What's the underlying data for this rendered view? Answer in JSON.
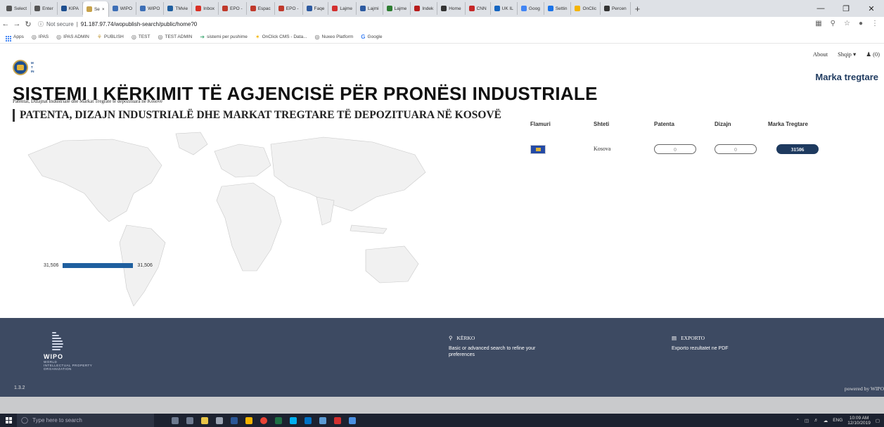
{
  "browser": {
    "tabs": [
      {
        "label": "Select",
        "color": "#555"
      },
      {
        "label": "Enter",
        "color": "#555"
      },
      {
        "label": "KIPA",
        "color": "#1d4e8f"
      },
      {
        "label": "Se",
        "color": "#c7a24a",
        "active": true
      },
      {
        "label": "WIPO",
        "color": "#3d6fb6"
      },
      {
        "label": "WIPO",
        "color": "#3d6fb6"
      },
      {
        "label": "TMvie",
        "color": "#1f5f9f"
      },
      {
        "label": "Inbox",
        "color": "#d93025"
      },
      {
        "label": "EPO -",
        "color": "#c0392b"
      },
      {
        "label": "Espac",
        "color": "#c0392b"
      },
      {
        "label": "EPO -",
        "color": "#c0392b"
      },
      {
        "label": "Faqe",
        "color": "#2d5aa0"
      },
      {
        "label": "Lajme",
        "color": "#d32f2f"
      },
      {
        "label": "Lajmi",
        "color": "#2d5aa0"
      },
      {
        "label": "Lajme",
        "color": "#2e7d32"
      },
      {
        "label": "Indek",
        "color": "#b71c1c"
      },
      {
        "label": "Home",
        "color": "#333"
      },
      {
        "label": "CNN",
        "color": "#c62828"
      },
      {
        "label": "UK IL",
        "color": "#1565c0"
      },
      {
        "label": "Goog",
        "color": "#4285f4"
      },
      {
        "label": "Settin",
        "color": "#1a73e8"
      },
      {
        "label": "OnClic",
        "color": "#f4b400"
      },
      {
        "label": "Percen",
        "color": "#333"
      }
    ],
    "url_prefix": "Not secure",
    "url": "91.187.97.74/wopublish-search/public/home?0",
    "bookmarks": [
      {
        "label": "Apps",
        "icon": "apps-grid-icon"
      },
      {
        "label": "IPAS",
        "icon": "globe-icon"
      },
      {
        "label": "IPAS ADMIN",
        "icon": "globe-icon"
      },
      {
        "label": "PUBLISH",
        "icon": "kipa-logo-icon"
      },
      {
        "label": "TEST",
        "icon": "globe-icon"
      },
      {
        "label": "TEST ADMIN",
        "icon": "globe-icon"
      },
      {
        "label": "sistemi per pushime",
        "icon": "arrow-icon"
      },
      {
        "label": "OnClick CMS - Data...",
        "icon": "onclick-icon"
      },
      {
        "label": "Nuxeo Platform",
        "icon": "globe-icon"
      },
      {
        "label": "Google",
        "icon": "google-icon"
      }
    ]
  },
  "header": {
    "about": "About",
    "language": "Shqip",
    "cart": "(0)",
    "logo_letters": [
      "M",
      "T",
      "IN"
    ],
    "marka": "Marka tregtare"
  },
  "main": {
    "title": "SISTEMI I KËRKIMIT TË AGJENCISË PËR PRONËSI INDUSTRIALE",
    "subtitle": "Patentat, Dizajnat Industriale dhe Markat Tregrate të depozituara në Kosovë",
    "section_title": "PATENTA, DIZAJN INDUSTRIALË DHE MARKAT TREGTARE TË DEPOZITUARA NË KOSOVË",
    "bar_min": "31,506",
    "bar_max": "31,506"
  },
  "table": {
    "headers": {
      "flag": "Flamuri",
      "country": "Shteti",
      "patent": "Patenta",
      "design": "Dizajn",
      "trademark": "Marka Tregtare"
    },
    "row": {
      "country": "Kosova",
      "patent": "0",
      "design": "0",
      "trademark": "31506"
    }
  },
  "footer": {
    "wipo_name": "WIPO",
    "wipo_sub_1": "WORLD",
    "wipo_sub_2": "INTELLECTUAL PROPERTY",
    "wipo_sub_3": "ORGANIZATION",
    "search_title": "KËRKO",
    "search_desc": "Basic or advanced search to refine your preferences",
    "export_title": "EXPORTO",
    "export_desc": "Exporto rezultatet ne PDF",
    "version": "1.3.2",
    "powered": "powered by WIPO"
  },
  "taskbar": {
    "search_placeholder": "Type here to search",
    "lang": "ENG",
    "time": "10:09 AM",
    "date": "12/10/2019"
  }
}
